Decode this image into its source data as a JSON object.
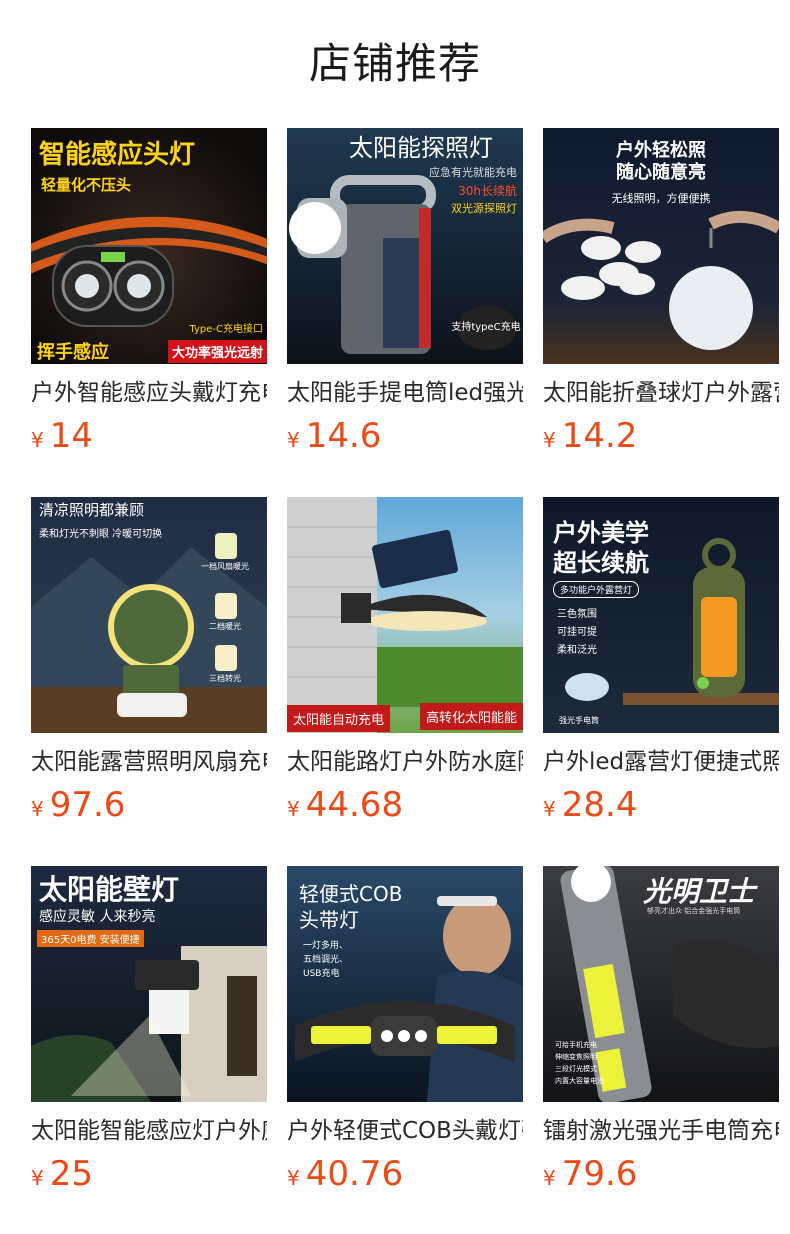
{
  "header": {
    "title": "店铺推荐"
  },
  "currency_symbol": "¥",
  "colors": {
    "price": "#ee4a18",
    "title": "#1a1a1a"
  },
  "products": [
    {
      "title": "户外智能感应头戴灯充电",
      "price": "14",
      "overlay": {
        "headline": "智能感应头灯",
        "sub": "轻量化不压头",
        "badge_left": "挥手感应",
        "badge_right": "大功率强光远射",
        "note": "Type-C充电接口"
      }
    },
    {
      "title": "太阳能手提电筒led强光",
      "price": "14.6",
      "overlay": {
        "headline": "太阳能探照灯",
        "line1": "应急有光就能充电",
        "line2": "30h长续航",
        "line3": "双光源探照灯",
        "badge": "支持typeC充电"
      }
    },
    {
      "title": "太阳能折叠球灯户外露营",
      "price": "14.2",
      "overlay": {
        "headline": "户外轻松照",
        "sub": "随心随意亮",
        "note": "无线照明，方便便携"
      }
    },
    {
      "title": "太阳能露营照明风扇充电",
      "price": "97.6",
      "overlay": {
        "headline": "清凉照明都兼顾",
        "sub": "柔和灯光不刺眼 冷暖可切换",
        "mode1": "一档风扇暖光",
        "mode2": "二档暖光",
        "mode3": "三档转光"
      }
    },
    {
      "title": "太阳能路灯户外防水庭院",
      "price": "44.68",
      "overlay": {
        "badge_left": "太阳能自动充电",
        "badge_right": "高转化太阳能能"
      }
    },
    {
      "title": "户外led露营灯便捷式照明",
      "price": "28.4",
      "overlay": {
        "headline": "户外美学",
        "sub": "超长续航",
        "tag": "多功能户外露营灯",
        "f1": "三色氛围",
        "f2": "可挂可提",
        "f3": "柔和泛光",
        "note": "强光手电筒"
      }
    },
    {
      "title": "太阳能智能感应灯户外庭院",
      "price": "25",
      "overlay": {
        "headline": "太阳能壁灯",
        "sub": "感应灵敏 人来秒亮",
        "tag": "365天0电费 安装便捷"
      }
    },
    {
      "title": "户外轻便式COB头戴灯强光",
      "price": "40.76",
      "overlay": {
        "headline": "轻便式COB",
        "sub": "头带灯",
        "f1": "一灯多用、",
        "f2": "五档调光、",
        "f3": "USB充电"
      }
    },
    {
      "title": "镭射激光强光手电筒充电",
      "price": "79.6",
      "overlay": {
        "headline": "光明卫士",
        "sub": "够亮才出众·铝合金强光手电筒",
        "f1": "可给手机充电",
        "f2": "伸缩变焦照明",
        "f3": "三段灯光模式",
        "f4": "内置大容量电池"
      }
    }
  ]
}
